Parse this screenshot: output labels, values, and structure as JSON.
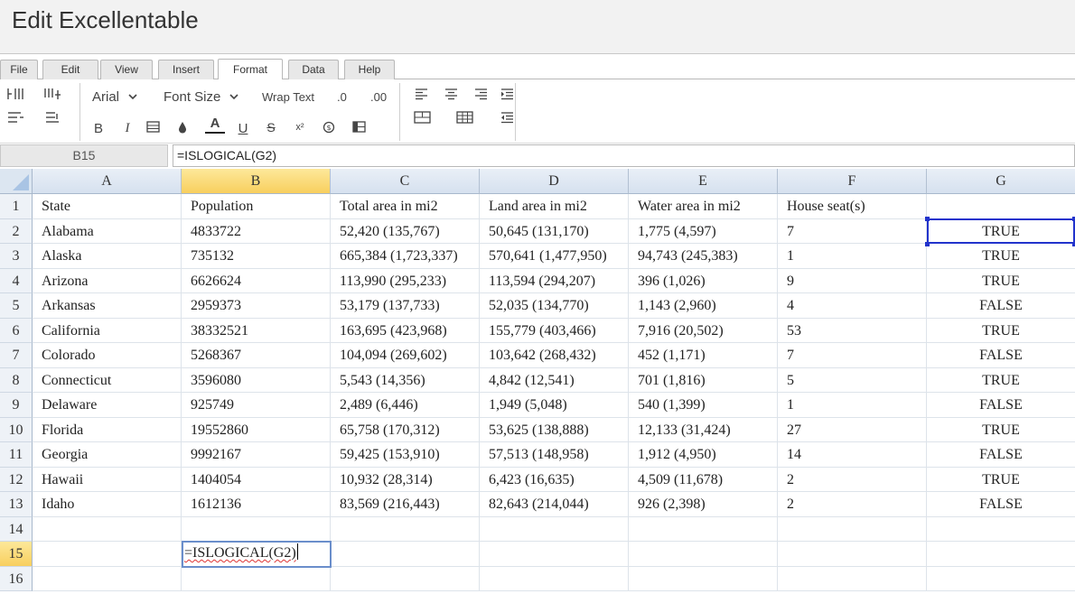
{
  "app": {
    "title": "Edit Excellentable"
  },
  "menu_tabs": [
    {
      "label": "File",
      "active": false
    },
    {
      "label": "Edit",
      "active": false
    },
    {
      "label": "View",
      "active": false
    },
    {
      "label": "Insert",
      "active": false
    },
    {
      "label": "Format",
      "active": true
    },
    {
      "label": "Data",
      "active": false
    },
    {
      "label": "Help",
      "active": false
    }
  ],
  "toolbar": {
    "font_family": "Arial",
    "font_size": "Font Size",
    "wrap_text": "Wrap Text",
    "decimal_decrease": ".0",
    "decimal_increase": ".00",
    "bold": "B",
    "italic": "I",
    "font_color": "A",
    "underline": "U",
    "strikethrough": "S",
    "superscript": "x²",
    "font_color_swatch": "#222222"
  },
  "formula_bar": {
    "cell_ref": "B15",
    "formula": "=ISLOGICAL(G2)"
  },
  "grid": {
    "columns": [
      "A",
      "B",
      "C",
      "D",
      "E",
      "F",
      "G"
    ],
    "selected_column": "B",
    "selected_row": "15",
    "row_numbers": [
      "1",
      "2",
      "3",
      "4",
      "5",
      "6",
      "7",
      "8",
      "9",
      "10",
      "11",
      "12",
      "13",
      "14",
      "15",
      "16"
    ],
    "rows": [
      [
        "State",
        "Population",
        "Total area in mi2",
        "Land area in mi2",
        "Water area in mi2",
        "House seat(s)",
        ""
      ],
      [
        "Alabama",
        "4833722",
        "52,420 (135,767)",
        "50,645 (131,170)",
        "1,775 (4,597)",
        "7",
        "TRUE"
      ],
      [
        "Alaska",
        "735132",
        "665,384 (1,723,337)",
        "570,641 (1,477,950)",
        "94,743 (245,383)",
        "1",
        "TRUE"
      ],
      [
        "Arizona",
        "6626624",
        "113,990 (295,233)",
        "113,594 (294,207)",
        "396 (1,026)",
        "9",
        "TRUE"
      ],
      [
        "Arkansas",
        "2959373",
        "53,179 (137,733)",
        "52,035 (134,770)",
        "1,143 (2,960)",
        "4",
        "FALSE"
      ],
      [
        "California",
        "38332521",
        "163,695 (423,968)",
        "155,779 (403,466)",
        "7,916 (20,502)",
        "53",
        "TRUE"
      ],
      [
        "Colorado",
        "5268367",
        "104,094 (269,602)",
        "103,642 (268,432)",
        "452 (1,171)",
        "7",
        "FALSE"
      ],
      [
        "Connecticut",
        "3596080",
        "5,543 (14,356)",
        "4,842 (12,541)",
        "701 (1,816)",
        "5",
        "TRUE"
      ],
      [
        "Delaware",
        "925749",
        "2,489 (6,446)",
        "1,949 (5,048)",
        "540 (1,399)",
        "1",
        "FALSE"
      ],
      [
        "Florida",
        "19552860",
        "65,758 (170,312)",
        "53,625 (138,888)",
        "12,133 (31,424)",
        "27",
        "TRUE"
      ],
      [
        "Georgia",
        "9992167",
        "59,425 (153,910)",
        "57,513 (148,958)",
        "1,912 (4,950)",
        "14",
        "FALSE"
      ],
      [
        "Hawaii",
        "1404054",
        "10,932 (28,314)",
        "6,423 (16,635)",
        "4,509 (11,678)",
        "2",
        "TRUE"
      ],
      [
        "Idaho",
        "1612136",
        "83,569 (216,443)",
        "82,643 (214,044)",
        "926 (2,398)",
        "2",
        "FALSE"
      ],
      [
        "",
        "",
        "",
        "",
        "",
        "",
        ""
      ],
      [
        "",
        "",
        "",
        "",
        "",
        "",
        ""
      ],
      [
        "",
        "",
        "",
        "",
        "",
        "",
        ""
      ]
    ],
    "editing_cell": {
      "ref": "B15",
      "value": "=ISLOGICAL(G2)"
    },
    "highlighted_cell": "G2"
  }
}
